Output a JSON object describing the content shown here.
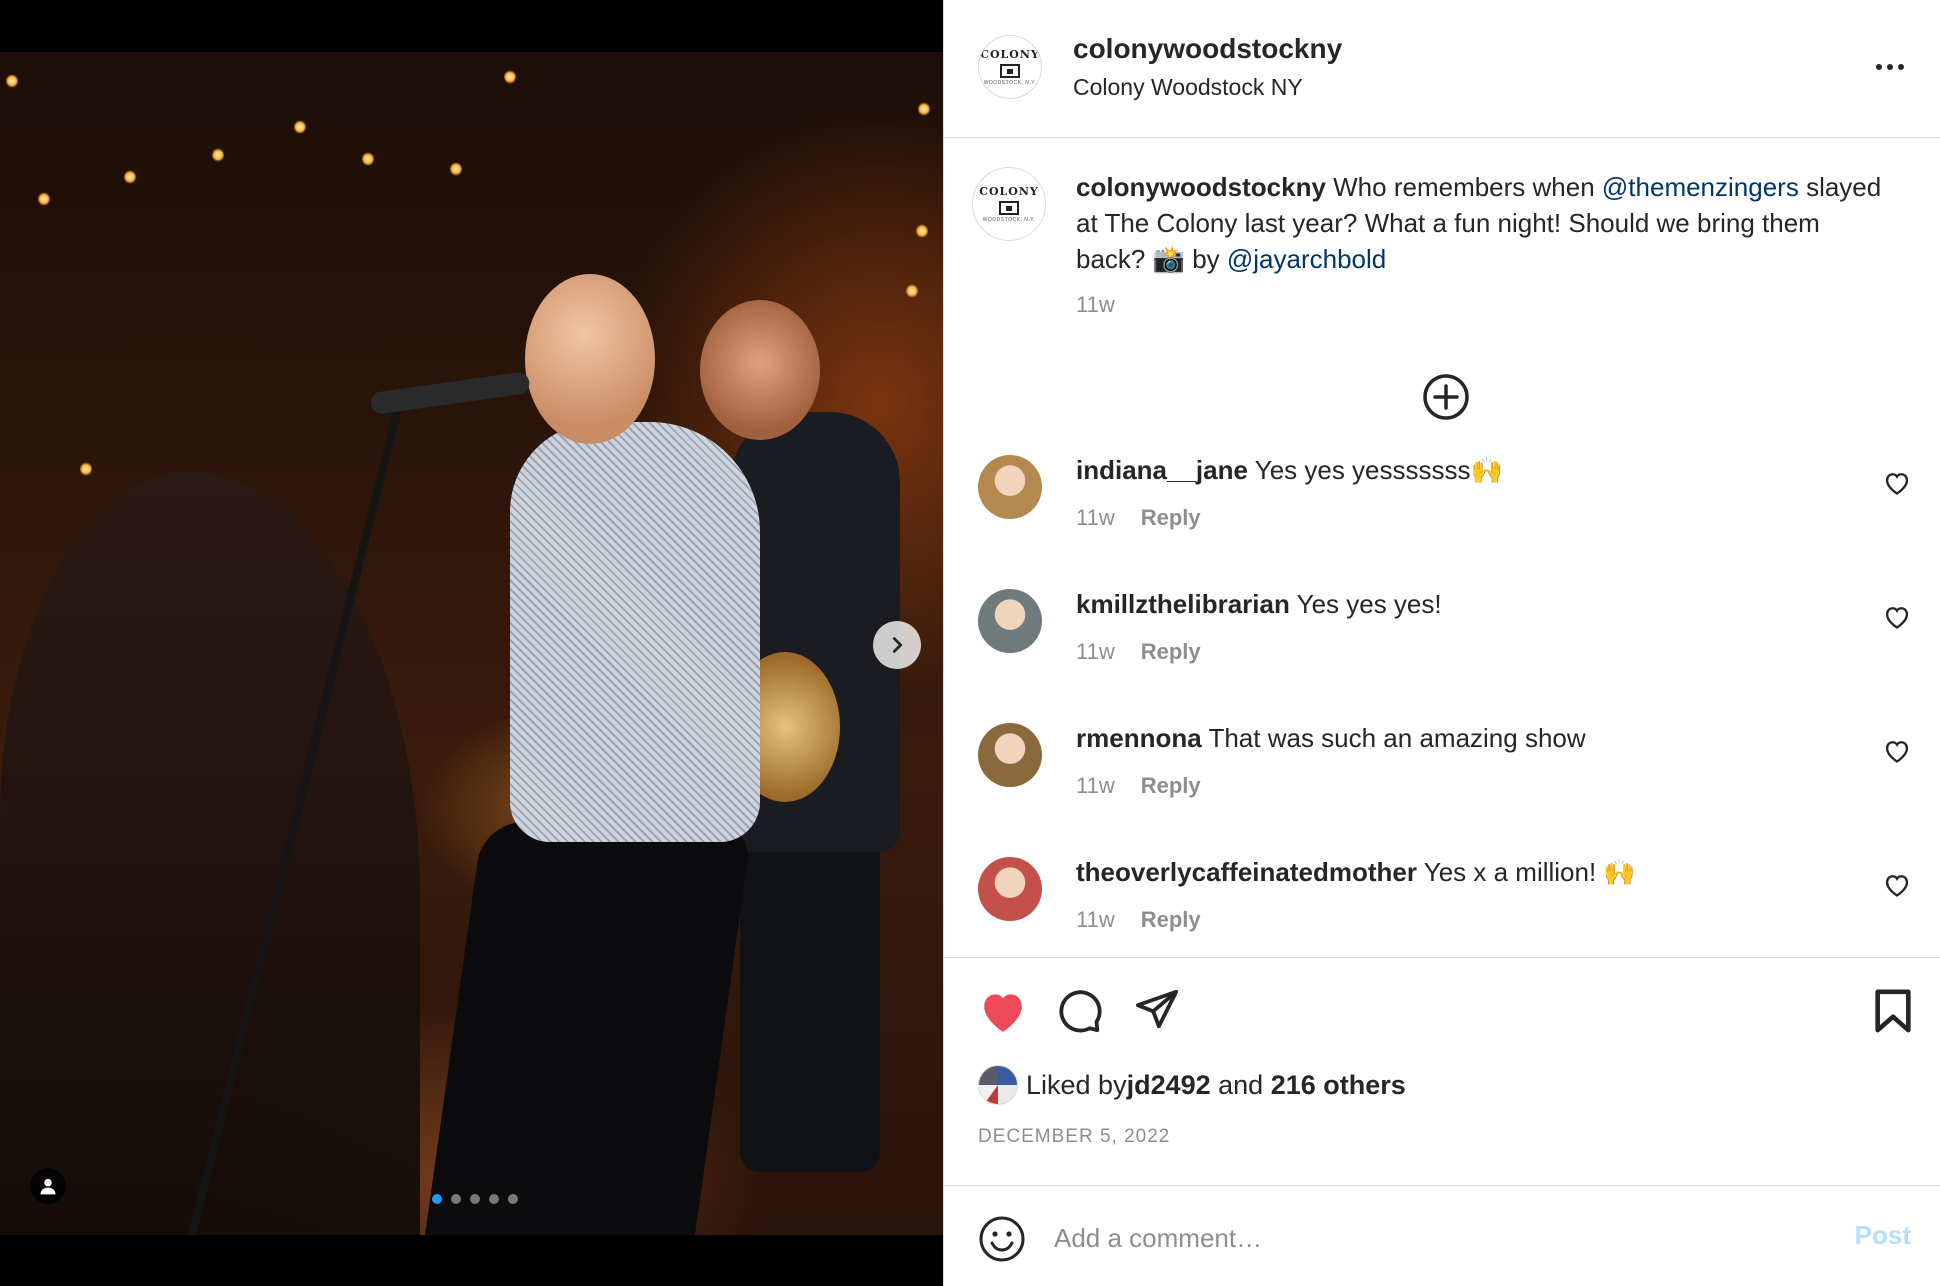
{
  "post": {
    "username": "colonywoodstockny",
    "location": "Colony Woodstock NY",
    "logo_text": "COLONY",
    "logo_sub": "WOODSTOCK, N.Y.",
    "caption": {
      "username": "colonywoodstockny",
      "text_1": " Who remembers when ",
      "mention_1": "@themenzingers",
      "text_2": " slayed at The Colony last year? What a fun night! Should we bring them back? 📸 by ",
      "mention_2": "@jayarchbold",
      "time": "11w"
    },
    "carousel": {
      "total": 5,
      "active_index": 0
    }
  },
  "comments": [
    {
      "username": "indiana__jane",
      "text": "Yes yes yesssssss🙌",
      "time": "11w",
      "reply": "Reply",
      "avatar_color": "#b5884f"
    },
    {
      "username": "kmillzthelibrarian",
      "text": "Yes yes yes!",
      "time": "11w",
      "reply": "Reply",
      "avatar_color": "#6f7a7c"
    },
    {
      "username": "rmennona",
      "text": "That was such an amazing show",
      "time": "11w",
      "reply": "Reply",
      "avatar_color": "#8a6a3c"
    },
    {
      "username": "theoverlycaffeinatedmother",
      "text": "Yes x a million! 🙌",
      "time": "11w",
      "reply": "Reply",
      "avatar_color": "#c4504a"
    }
  ],
  "actions": {
    "liked": true,
    "heart_color": "#ed4956",
    "liked_by_prefix": "Liked by ",
    "liked_by_user": "jd2492",
    "liked_by_and": " and ",
    "liked_by_others": "216 others",
    "date": "DECEMBER 5, 2022"
  },
  "comment_box": {
    "placeholder": "Add a comment…",
    "post_label": "Post"
  },
  "icons": {
    "more": "more-horizontal-icon",
    "add_comment": "plus-circle-icon",
    "next": "chevron-right-icon",
    "tag": "user-tag-icon",
    "heart": "heart-icon",
    "comment": "comment-icon",
    "share": "paper-plane-icon",
    "save": "bookmark-icon",
    "emoji": "emoji-icon"
  }
}
